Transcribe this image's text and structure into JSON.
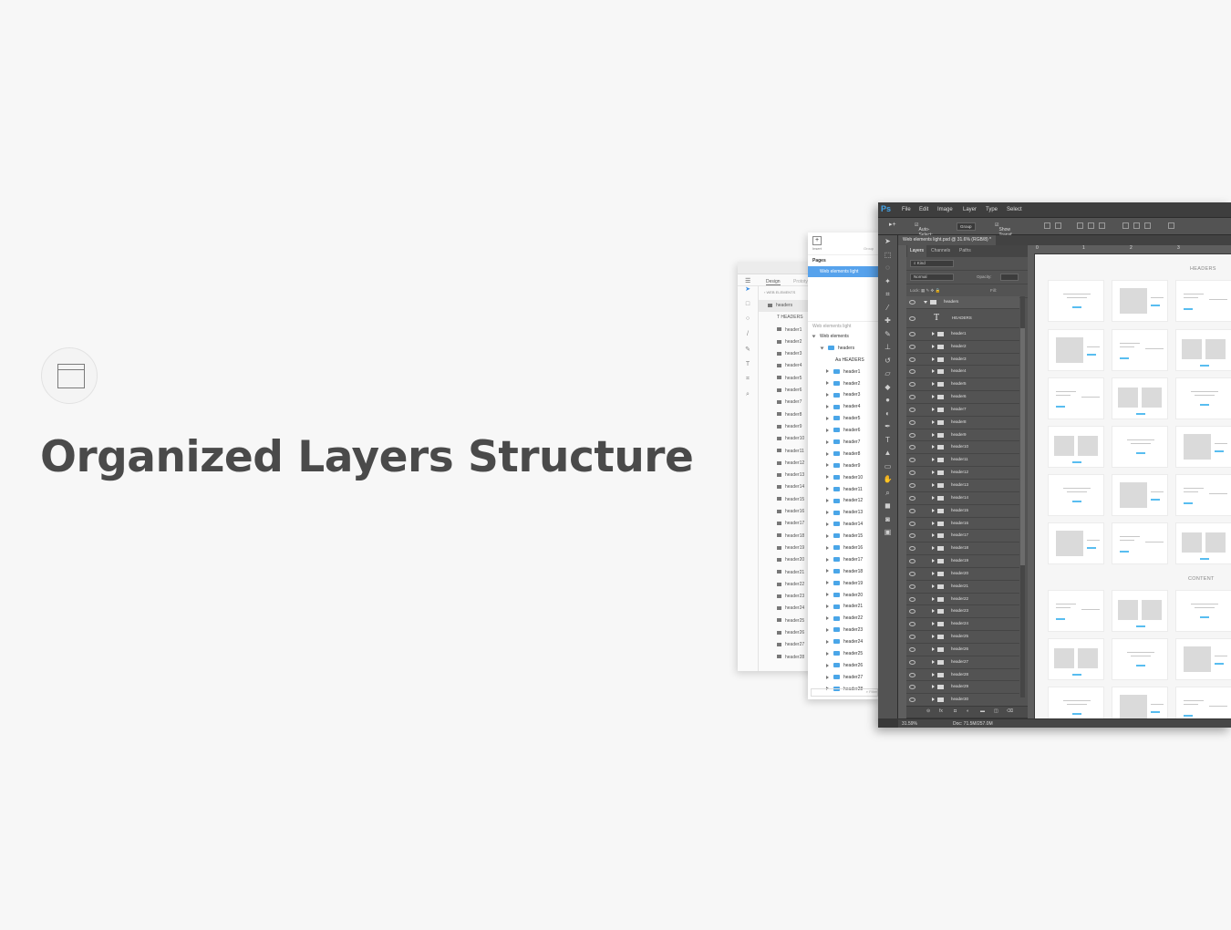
{
  "hero": {
    "icon": "window-icon",
    "title": "Organized Layers Structure"
  },
  "sketch": {
    "tabs": [
      "Design",
      "Prototy"
    ],
    "breadcrumb": "WEB ELEMENTS",
    "group": "headers",
    "text_layer": "HEADERS",
    "items": [
      "header1",
      "header2",
      "header3",
      "header4",
      "header5",
      "header6",
      "header7",
      "header8",
      "header9",
      "header10",
      "header11",
      "header12",
      "header13",
      "header14",
      "header15",
      "header16",
      "header17",
      "header18",
      "header19",
      "header20",
      "header21",
      "header22",
      "header23",
      "header24",
      "header25",
      "header26",
      "header27",
      "header28"
    ]
  },
  "figma": {
    "insert_label": "Insert",
    "group_label": "Group",
    "pages_label": "Pages",
    "selected_page": "Web elements light",
    "frame_label": "Web elements light",
    "root": "Web elements",
    "group": "headers",
    "text_layer": "HEADERS",
    "items": [
      "header1",
      "header2",
      "header3",
      "header4",
      "header5",
      "header6",
      "header7",
      "header8",
      "header9",
      "header10",
      "header11",
      "header12",
      "header13",
      "header14",
      "header15",
      "header16",
      "header17",
      "header18",
      "header19",
      "header20",
      "header21",
      "header22",
      "header23",
      "header24",
      "header25",
      "header26",
      "header27",
      "header28"
    ],
    "search_placeholder": "Filter"
  },
  "photoshop": {
    "logo": "Ps",
    "menu": [
      "File",
      "Edit",
      "Image",
      "Layer",
      "Type",
      "Select"
    ],
    "options": {
      "auto_select": "Auto-Select:",
      "group": "Group",
      "show_transform": "Show Transf."
    },
    "document_tab": "Web elements light.psd @ 31.6% (RGB/8) *",
    "panel_tabs": [
      "Layers",
      "Channels",
      "Paths"
    ],
    "filter_kind": "Kind",
    "blend_mode": "Normal",
    "opacity_label": "Opacity:",
    "lock_label": "Lock:",
    "fill_label": "Fill:",
    "group_headers": "headers",
    "text_layer": "HEADERS",
    "layers": [
      "header1",
      "header2",
      "header3",
      "header4",
      "header5",
      "header6",
      "header7",
      "header8",
      "header9",
      "header10",
      "header11",
      "header12",
      "header13",
      "header14",
      "header15",
      "header16",
      "header17",
      "header18",
      "header19",
      "header20",
      "header21",
      "header22",
      "header23",
      "header24",
      "header25",
      "header26",
      "header27",
      "header28",
      "header29",
      "header30"
    ],
    "other_groups": [
      "content",
      "sliders"
    ],
    "zoom": "31.59%",
    "doc_info": "Doc: 71.5M/257.0M",
    "ruler_marks": [
      "0",
      "1",
      "2",
      "3"
    ],
    "canvas_labels": [
      "HEADERS",
      "CONTENT"
    ]
  }
}
